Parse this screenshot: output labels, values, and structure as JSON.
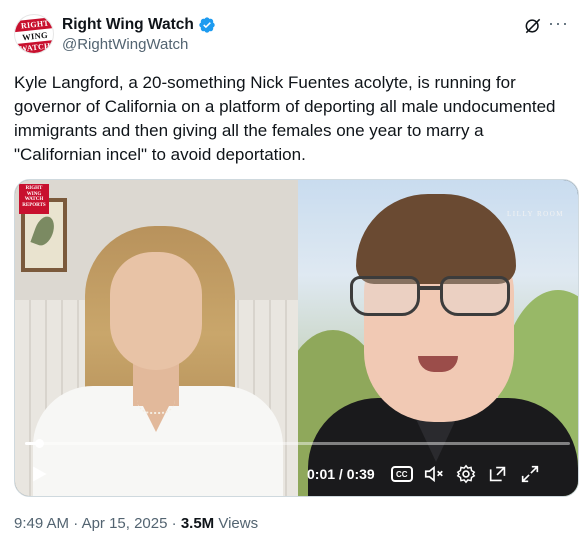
{
  "author": {
    "display_name": "Right Wing Watch",
    "handle": "@RightWingWatch",
    "verified": true,
    "avatar_text": [
      "RIGHT",
      "WING",
      "WATCH"
    ],
    "verified_color": "#1d9bf0"
  },
  "header_icons": {
    "grok": "grok-icon",
    "more": "···"
  },
  "tweet": {
    "text": "Kyle Langford, a 20-something Nick Fuentes acolyte, is running for governor of California on a platform of deporting all male undocumented immigrants and then giving all the females one year to marry a \"Californian incel\" to avoid deportation."
  },
  "video": {
    "watermark_left": "RIGHT WING WATCH REPORTS",
    "watermark_right": "LILLY ROOM",
    "time_display": "0:01 / 0:39",
    "progress_fraction": 0.026,
    "controls": [
      "play-icon",
      "captions-icon",
      "mute-icon",
      "settings-icon",
      "pip-icon",
      "fullscreen-icon"
    ],
    "cc_label": "CC"
  },
  "meta": {
    "time": "9:49 AM",
    "date": "Apr 15, 2025",
    "separator": "·",
    "views_count": "3.5M",
    "views_label": "Views"
  }
}
